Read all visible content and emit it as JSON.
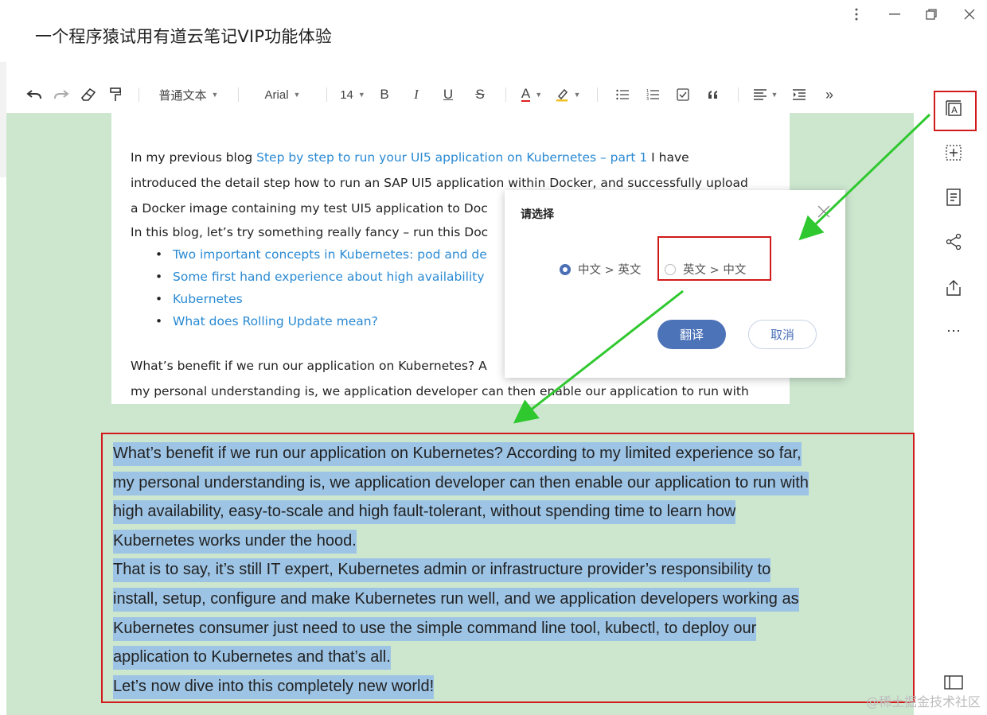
{
  "window": {
    "title": "一个程序猿试用有道云笔记VIP功能体验"
  },
  "toolbar": {
    "style_select": "普通文本",
    "font_select": "Arial",
    "size_select": "14",
    "bold": "B",
    "italic": "I",
    "underline": "U",
    "strike": "S",
    "font_color": "A",
    "more": "»"
  },
  "image_content": {
    "p1_before": "In my previous blog ",
    "p1_link": "Step by step to run your UI5 application on Kubernetes – part 1",
    "p1_after": " I have",
    "line2": "introduced the detail step how to run an SAP UI5 application within Docker, and successfully upload",
    "line3": "a Docker image containing my test UI5 application to Doc",
    "line4": "In this blog, let’s try something really fancy – run this Doc",
    "bullets": [
      "Two important concepts in Kubernetes: pod and de",
      "Some first hand experience about high availability",
      "Kubernetes",
      "What does Rolling Update mean?"
    ],
    "line5": "What’s benefit if we run our application on Kubernetes? A",
    "line6": "my personal understanding is, we application developer can then enable our application to run with"
  },
  "dialog": {
    "title": "请选择",
    "option_cn_en": "中文 > 英文",
    "option_en_cn": "英文 > 中文",
    "selected": "cn_en",
    "translate_button": "翻译",
    "cancel_button": "取消"
  },
  "selected_text": {
    "lines": [
      "What’s benefit if we run our application on Kubernetes? According to my limited experience so far,",
      "my personal understanding is, we application developer can then enable our application to run with",
      "high availability, easy-to-scale and high fault-tolerant, without spending time to learn how",
      "Kubernetes works under the hood.",
      "That is to say, it’s still IT expert, Kubernetes admin or infrastructure provider’s responsibility to",
      "install, setup, configure and make Kubernetes run well, and we application developers working as",
      "Kubernetes consumer just need to use the simple command line tool, kubectl, to deploy our",
      "application to Kubernetes and that’s all.",
      "Let’s now dive into this completely new world!"
    ]
  },
  "sidebar": {
    "more": "⋯"
  },
  "watermark": "@稀土掘金技术社区",
  "colors": {
    "editor_bg": "#cde7cf",
    "selection": "#9dc4e5",
    "link": "#2a8ad3",
    "primary_button": "#4c72b8",
    "annotation_red": "#d11a1a",
    "annotation_arrow": "#2fc82f"
  }
}
